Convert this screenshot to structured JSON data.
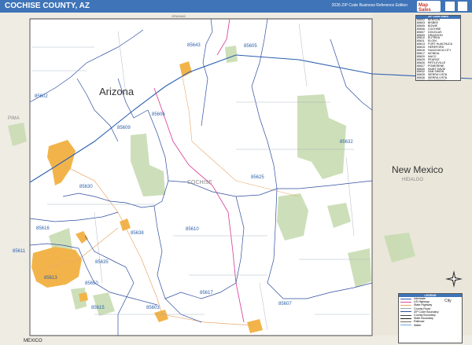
{
  "header": {
    "title": "COCHISE COUNTY, AZ",
    "edition": "2026 ZIP Code Business Reference Edition",
    "logo": "Map Sales"
  },
  "map": {
    "state_label": "Arizona",
    "neighbor_state": "New Mexico",
    "neighbor_county": "HIDALGO",
    "county_label": "COCHISE",
    "west_county": "PIMA",
    "north_county": "GRAHAM",
    "south_label": "MEXICO",
    "zip_labels": [
      "85643",
      "85605",
      "85602",
      "85606",
      "85609",
      "85632",
      "85630",
      "85625",
      "85616",
      "85638",
      "85610",
      "85611",
      "85635",
      "85613",
      "85650",
      "85617",
      "85603",
      "85615",
      "85607"
    ]
  },
  "zip_index": {
    "header": "ZIP Code Index",
    "rows": [
      [
        "85602",
        "BENSON"
      ],
      [
        "85603",
        "BISBEE"
      ],
      [
        "85605",
        "BOWIE"
      ],
      [
        "85606",
        "COCHISE"
      ],
      [
        "85607",
        "DOUGLAS"
      ],
      [
        "85609",
        "DRAGOON"
      ],
      [
        "85610",
        "ELFRIDA"
      ],
      [
        "85611",
        "ELGIN"
      ],
      [
        "85613",
        "FORT HUACHUCA"
      ],
      [
        "85615",
        "HEREFORD"
      ],
      [
        "85616",
        "HUACHUCA CITY"
      ],
      [
        "85617",
        "MCNEAL"
      ],
      [
        "85620",
        "NACO"
      ],
      [
        "85625",
        "PEARCE"
      ],
      [
        "85626",
        "PIRTLEVILLE"
      ],
      [
        "85627",
        "POMERENE"
      ],
      [
        "85630",
        "SAINT DAVID"
      ],
      [
        "85632",
        "SAN SIMON"
      ],
      [
        "85635",
        "SIERRA VISTA"
      ],
      [
        "85636",
        "SIERRA VISTA"
      ],
      [
        "85638",
        "TOMBSTONE"
      ],
      [
        "85643",
        "WILLCOX"
      ],
      [
        "85650",
        "SIERRA VISTA"
      ]
    ]
  },
  "legend": {
    "header": "LEGEND",
    "items": [
      "Interstate",
      "US Highway",
      "State Highway",
      "County Road",
      "ZIP Code Boundary",
      "County Boundary",
      "State Boundary",
      "Railroad",
      "Water"
    ],
    "city_label": "City"
  },
  "colors": {
    "header_bg": "#3f74b8",
    "zip_label": "#2b5fa8",
    "zip_boundary": "#2e4d9e",
    "city_fill": "#f2b44a",
    "green_area": "#c8dcb2",
    "outer_bg": "#e8e3d8",
    "highway": "#2c5fb0",
    "us_route": "#d94aa0"
  }
}
